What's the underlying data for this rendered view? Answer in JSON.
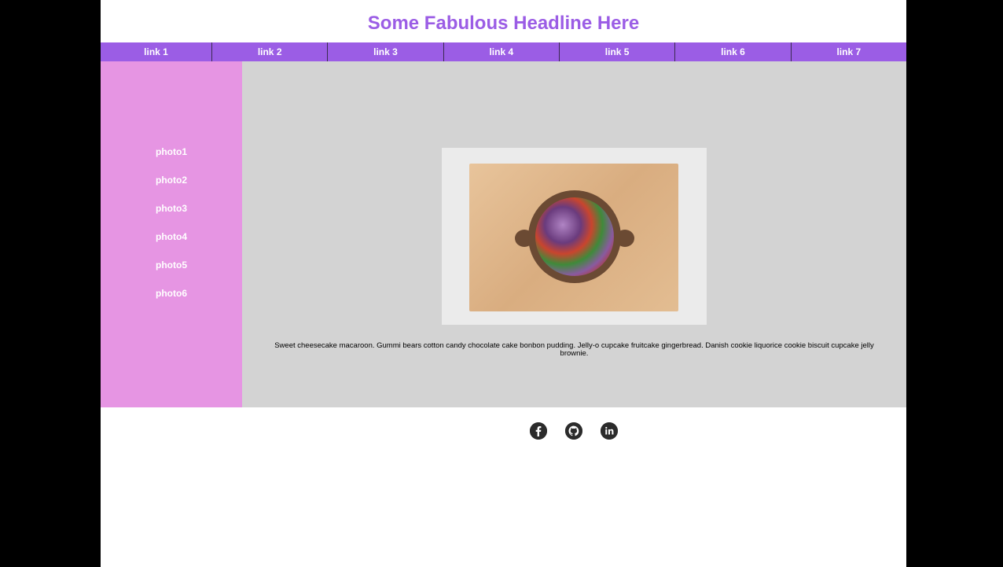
{
  "header": {
    "title": "Some Fabulous Headline Here"
  },
  "nav": [
    "link 1",
    "link 2",
    "link 3",
    "link 4",
    "link 5",
    "link 6",
    "link 7"
  ],
  "sidebar": [
    "photo1",
    "photo2",
    "photo3",
    "photo4",
    "photo5",
    "photo6"
  ],
  "main": {
    "caption": "Sweet cheesecake macaroon. Gummi bears cotton candy chocolate cake bonbon pudding. Jelly-o cupcake fruitcake gingerbread. Danish cookie liquorice cookie biscuit cupcake jelly brownie."
  },
  "colors": {
    "accent": "#9b5de5",
    "sidebar": "#e695e3",
    "main_bg": "#d3d3d3"
  },
  "footer": {
    "icons": [
      "facebook-icon",
      "github-icon",
      "linkedin-icon"
    ]
  }
}
